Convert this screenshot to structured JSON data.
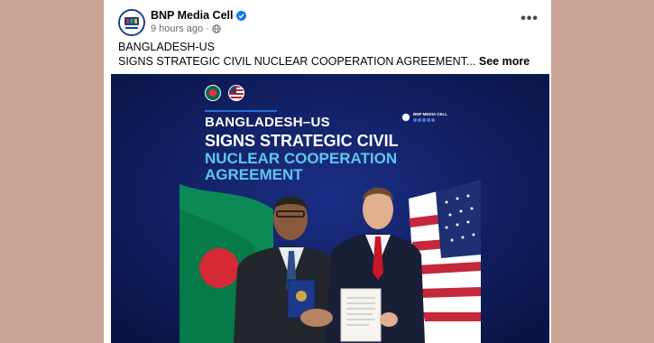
{
  "post": {
    "author": "BNP Media Cell",
    "time": "9 hours ago",
    "separator": "·",
    "text_line1": "BANGLADESH-US",
    "text_line2": "SIGNS STRATEGIC CIVIL NUCLEAR COOPERATION AGREEMENT...",
    "see_more": "See more",
    "more_options": "•••"
  },
  "image": {
    "headline_1": "BANGLADESH–US",
    "headline_2": "SIGNS STRATEGIC CIVIL",
    "headline_3": "NUCLEAR COOPERATION",
    "headline_4": "AGREEMENT",
    "brand_name": "BNP MEDIA CELL"
  },
  "colors": {
    "page_background": "#c8a393",
    "image_background": "#0c1a52",
    "headline_accent": "#5ec8f0",
    "verified_badge": "#1877f2"
  },
  "icons": {
    "verified": "verified-badge-icon",
    "audience": "globe-icon",
    "options": "more-horizontal-icon"
  }
}
